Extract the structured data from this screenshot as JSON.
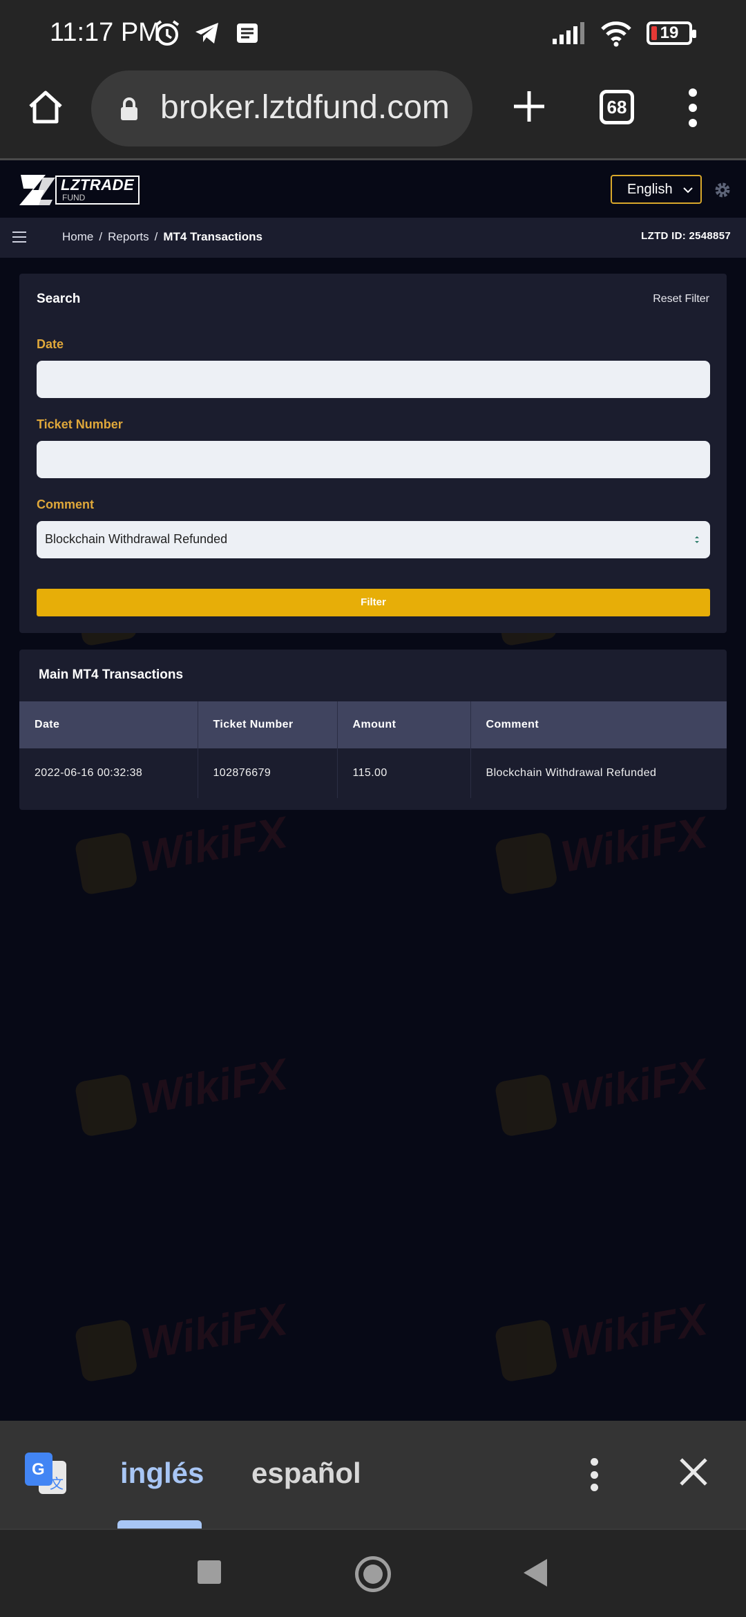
{
  "status_bar": {
    "time": "11:17 PM",
    "battery": "19"
  },
  "browser": {
    "url": "broker.lztdfund.com",
    "tab_count": "68"
  },
  "site": {
    "logo_name": "LZTRADE",
    "logo_sub": "FUND",
    "language": "English"
  },
  "breadcrumb": {
    "items": [
      "Home",
      "Reports",
      "MT4 Transactions"
    ],
    "separator": "/",
    "account_id": "LZTD ID: 2548857"
  },
  "search": {
    "title": "Search",
    "reset_label": "Reset Filter",
    "date_label": "Date",
    "date_value": "",
    "ticket_label": "Ticket Number",
    "ticket_value": "",
    "comment_label": "Comment",
    "comment_value": "Blockchain Withdrawal Refunded",
    "filter_label": "Filter"
  },
  "transactions": {
    "title": "Main MT4 Transactions",
    "columns": [
      "Date",
      "Ticket Number",
      "Amount",
      "Comment"
    ],
    "rows": [
      [
        "2022-06-16 00:32:38",
        "102876679",
        "115.00",
        "Blockchain Withdrawal Refunded"
      ]
    ]
  },
  "translate_bar": {
    "source_lang": "inglés",
    "target_lang": "español"
  },
  "watermark_text": "WikiFX",
  "colors": {
    "page_bg": "#070916",
    "card_bg": "#1b1d2e",
    "accent_gold": "#e7ae08",
    "label_gold": "#e0a83a",
    "table_header": "#40445f"
  }
}
